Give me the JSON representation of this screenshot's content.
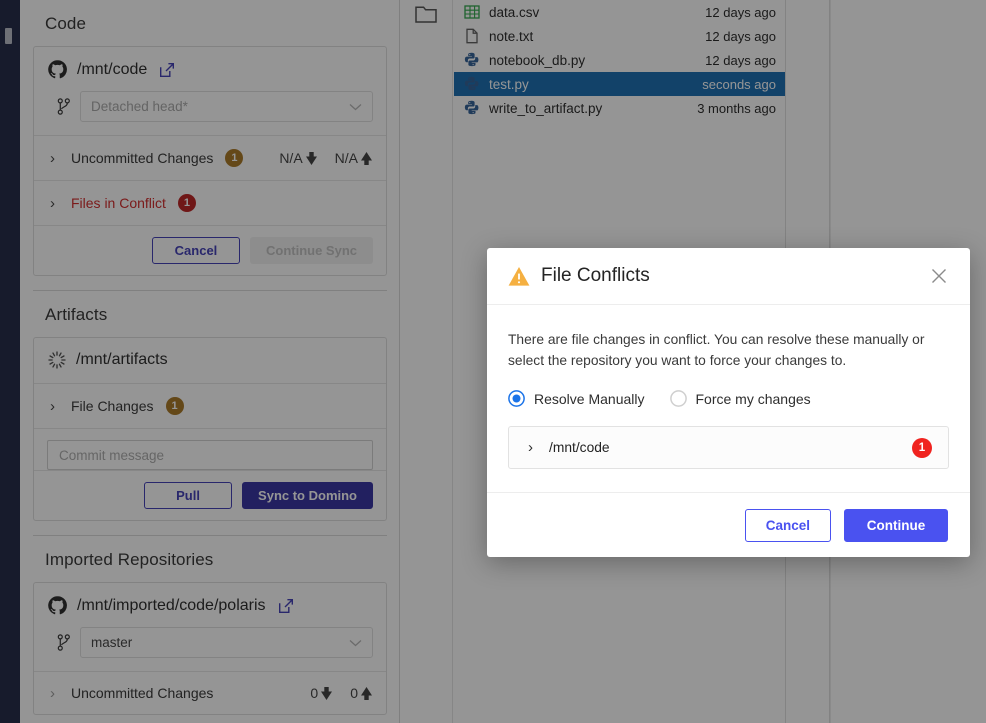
{
  "colors": {
    "rail": "#1b2240",
    "primary": "#4a52f0",
    "panel_primary": "#2f2b9e",
    "badge_amber": "#a6731d",
    "badge_red": "#bb1b1b",
    "badge_bright_red": "#f0231f",
    "selected_row": "#1269b0",
    "warning": "#f5b041",
    "radio_blue": "#1a73e8",
    "danger_text": "#cf2222"
  },
  "git_panel": {
    "code": {
      "title": "Code",
      "repo_path": "/mnt/code",
      "external_link_icon": "external-link-icon",
      "repo_icon": "github-icon",
      "branch_icon": "git-branch-icon",
      "branch_value": "Detached head*",
      "uncommitted": {
        "label": "Uncommitted Changes",
        "badge": "1",
        "behind": "N/A",
        "ahead": "N/A"
      },
      "conflicts": {
        "label": "Files in Conflict",
        "badge": "1"
      },
      "cancel_label": "Cancel",
      "continue_sync_label": "Continue Sync"
    },
    "artifacts": {
      "title": "Artifacts",
      "repo_path": "/mnt/artifacts",
      "repo_icon": "artifacts-icon",
      "file_changes": {
        "label": "File Changes",
        "badge": "1"
      },
      "commit_placeholder": "Commit message",
      "commit_value": "",
      "pull_label": "Pull",
      "sync_label": "Sync to Domino"
    },
    "imported": {
      "title": "Imported Repositories",
      "repo_path": "/mnt/imported/code/polaris",
      "repo_icon": "github-icon",
      "external_link_icon": "external-link-icon",
      "branch_icon": "git-branch-icon",
      "branch_value": "master",
      "uncommitted": {
        "label": "Uncommitted Changes",
        "behind": "0",
        "ahead": "0"
      }
    }
  },
  "file_browser": {
    "folder_icon": "folder-icon",
    "files": [
      {
        "name": "data.csv",
        "time": "12 days ago",
        "icon": "csv-file-icon",
        "selected": false
      },
      {
        "name": "note.txt",
        "time": "12 days ago",
        "icon": "text-file-icon",
        "selected": false
      },
      {
        "name": "notebook_db.py",
        "time": "12 days ago",
        "icon": "python-file-icon",
        "selected": false
      },
      {
        "name": "test.py",
        "time": "seconds ago",
        "icon": "python-file-icon",
        "selected": true
      },
      {
        "name": "write_to_artifact.py",
        "time": "3 months ago",
        "icon": "python-file-icon",
        "selected": false
      }
    ]
  },
  "modal": {
    "warning_icon": "warning-triangle-icon",
    "title": "File Conflicts",
    "close_icon": "close-icon",
    "description": "There are file changes in conflict. You can resolve these manually or select the repository you want to force your changes to.",
    "options": [
      {
        "label": "Resolve Manually",
        "selected": true
      },
      {
        "label": "Force my changes",
        "selected": false
      }
    ],
    "conflict_repo": {
      "chevron": "›",
      "path": "/mnt/code",
      "badge": "1"
    },
    "cancel_label": "Cancel",
    "continue_label": "Continue"
  }
}
